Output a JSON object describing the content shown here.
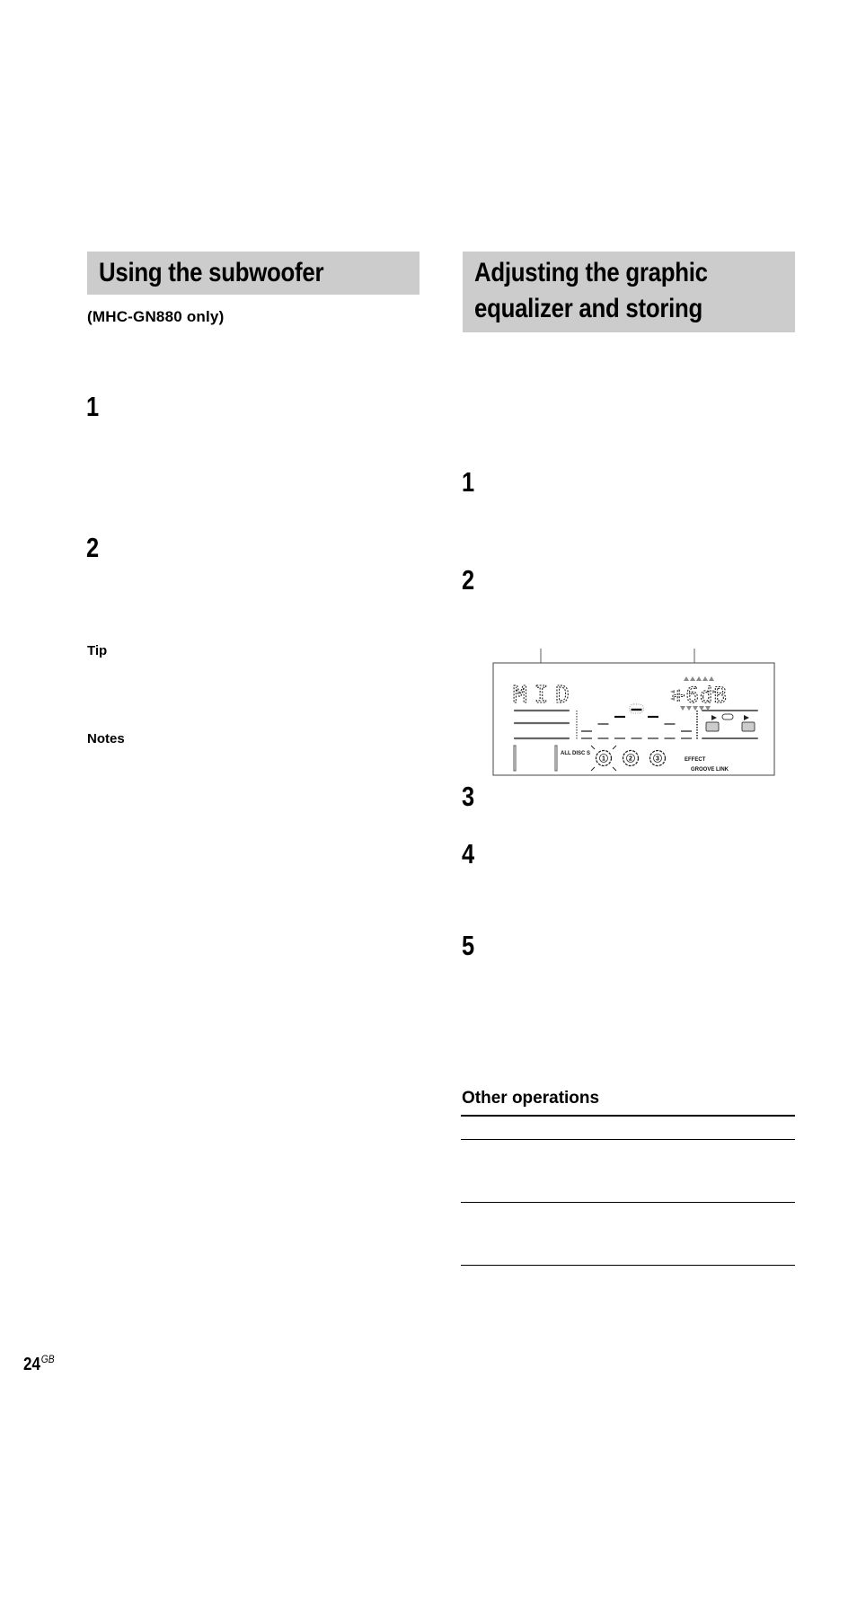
{
  "page": {
    "number": "24",
    "number_suffix": "GB"
  },
  "left": {
    "title": "Using the subwoofer",
    "subtitle": "(MHC-GN880 only)",
    "steps": [
      "1",
      "2"
    ],
    "tip_label": "Tip",
    "notes_label": "Notes"
  },
  "right": {
    "title_line1": "Adjusting the graphic",
    "title_line2": "equalizer and storing",
    "steps": [
      "1",
      "2",
      "3",
      "4",
      "5"
    ],
    "display": {
      "band_label": "MID",
      "level_value": "+6dB",
      "indicators": {
        "all": "ALL",
        "discs": "DISC S",
        "effect": "EFFECT",
        "groove_link": "GROOVE LINK"
      },
      "disc_trays": [
        "1",
        "2",
        "3"
      ],
      "eq_bands": [
        1,
        2,
        3,
        4,
        3,
        2,
        1
      ],
      "selected_band_index": 3
    },
    "other_operations": {
      "heading": "Other operations",
      "rows": [
        "",
        "",
        ""
      ]
    }
  }
}
